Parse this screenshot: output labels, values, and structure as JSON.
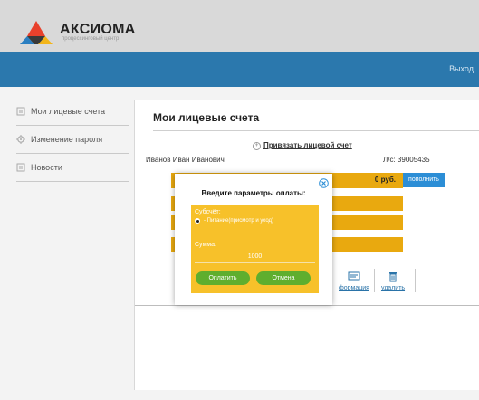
{
  "brand": {
    "name": "АКСИОМА",
    "tagline": "процессинговый центр"
  },
  "topbar": {
    "logout_label": "Выход"
  },
  "sidebar": {
    "items": [
      {
        "label": "Мои лицевые счета",
        "icon": "wallet-icon"
      },
      {
        "label": "Изменение пароля",
        "icon": "gear-icon"
      },
      {
        "label": "Новости",
        "icon": "news-icon"
      }
    ]
  },
  "main": {
    "title": "Мои лицевые счета",
    "bind_account_link": "Привязать лицевой счет",
    "holder_name": "Иванов Иван Иванович",
    "account_number": "Л/с: 39005435",
    "balance": "0 руб.",
    "topup_label": "пополнить",
    "info_label": "формация",
    "delete_label": "удалить"
  },
  "modal": {
    "title": "Введите параметры оплаты:",
    "subaccount_label": "Субсчёт:",
    "subaccount_option": "- Питание(присмотр и уход)",
    "sum_label": "Сумма:",
    "sum_value": "1000",
    "pay_label": "Оплатить",
    "cancel_label": "Отмена"
  },
  "colors": {
    "topbar": "#2b78ad",
    "accent_orange": "#e9a90f",
    "modal_panel": "#f7c12a",
    "button_green": "#5fae2e",
    "topup_blue": "#2c8ed6"
  }
}
